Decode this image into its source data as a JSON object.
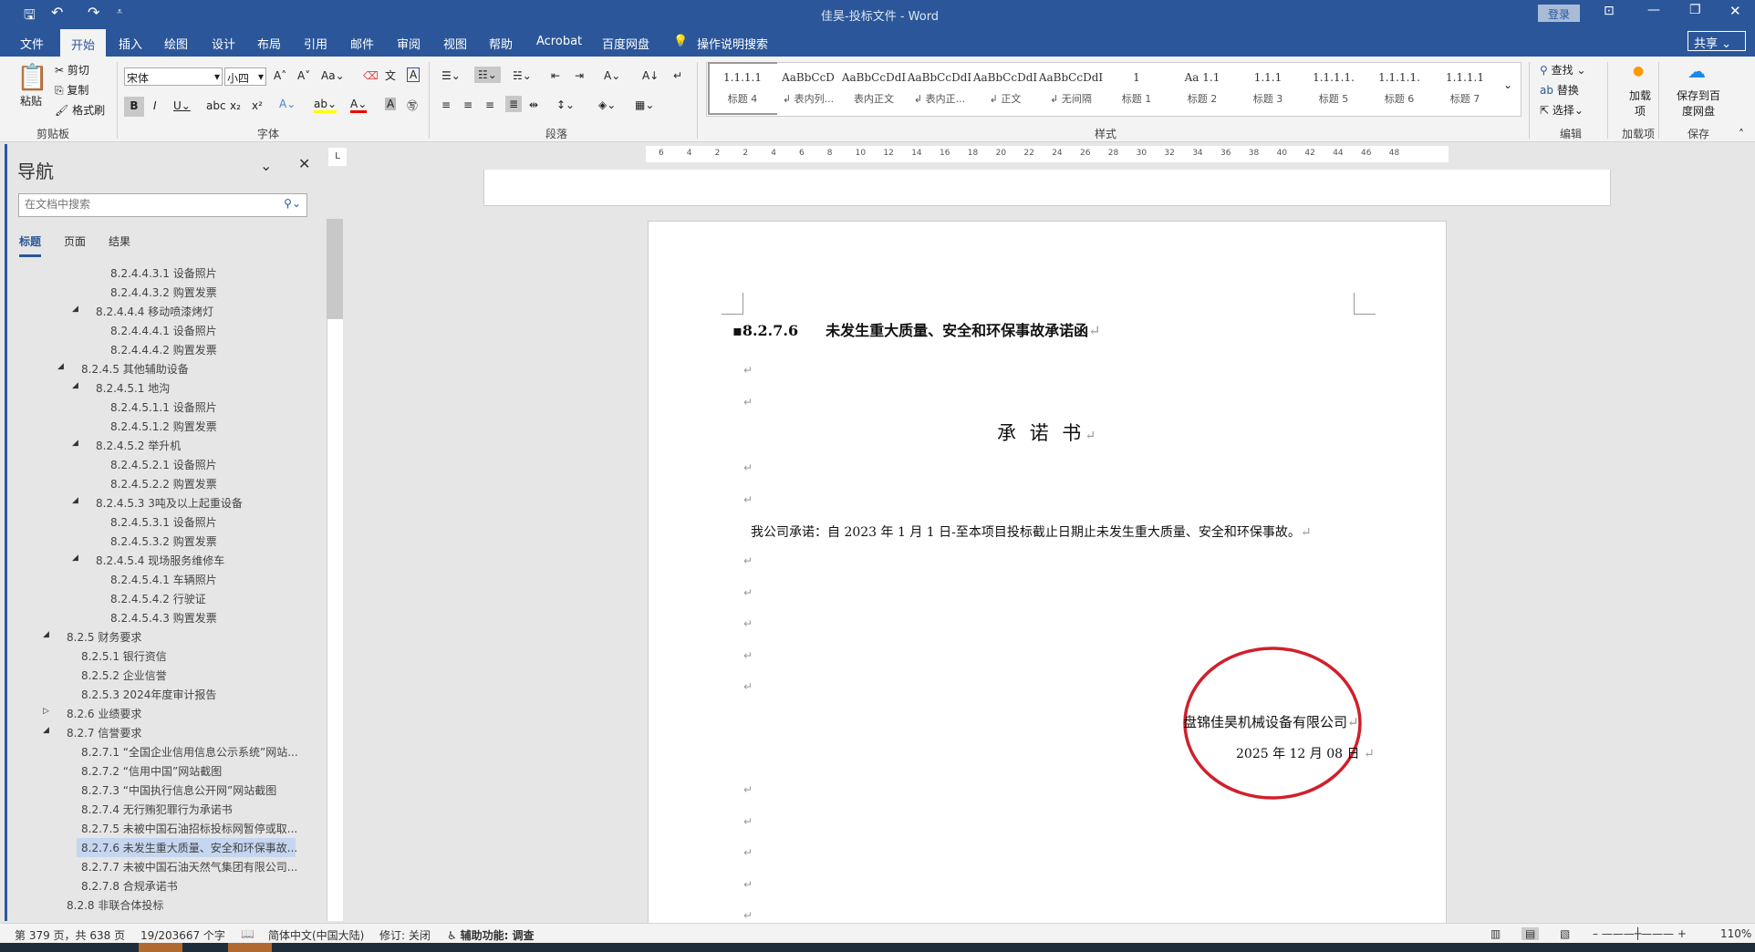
{
  "window": {
    "title": "佳昊-投标文件 - Word",
    "login": "登录",
    "share": "共享"
  },
  "tabs": [
    "文件",
    "开始",
    "插入",
    "绘图",
    "设计",
    "布局",
    "引用",
    "邮件",
    "审阅",
    "视图",
    "帮助",
    "Acrobat",
    "百度网盘"
  ],
  "tell_me": "操作说明搜索",
  "clipboard": {
    "paste": "粘贴",
    "cut": "剪切",
    "copy": "复制",
    "format_painter": "格式刷",
    "label": "剪贴板"
  },
  "font": {
    "name": "宋体",
    "size": "小四",
    "label": "字体"
  },
  "paragraph": {
    "label": "段落"
  },
  "styles": {
    "label": "样式",
    "items": [
      {
        "preview": "1.1.1.1",
        "name": "标题 4"
      },
      {
        "preview": "AaBbCcD",
        "name": "↲ 表内列..."
      },
      {
        "preview": "AaBbCcDdI",
        "name": "表内正文"
      },
      {
        "preview": "AaBbCcDdI",
        "name": "↲ 表内正..."
      },
      {
        "preview": "AaBbCcDdI",
        "name": "↲ 正文"
      },
      {
        "preview": "AaBbCcDdI",
        "name": "↲ 无间隔"
      },
      {
        "preview": "1",
        "name": "标题 1"
      },
      {
        "preview": "Aa 1.1",
        "name": "标题 2"
      },
      {
        "preview": "1.1.1",
        "name": "标题 3"
      },
      {
        "preview": "1.1.1.1.",
        "name": "标题 5"
      },
      {
        "preview": "1.1.1.1.",
        "name": "标题 6"
      },
      {
        "preview": "1.1.1.1",
        "name": "标题 7"
      }
    ]
  },
  "editing": {
    "find": "查找",
    "replace": "替换",
    "select": "选择",
    "label": "编辑"
  },
  "addins": {
    "button": "加载项",
    "label": "加载项"
  },
  "save": {
    "button": "保存到百度网盘",
    "label": "保存"
  },
  "nav": {
    "title": "导航",
    "search_placeholder": "在文档中搜索",
    "tabs": [
      "标题",
      "页面",
      "结果"
    ],
    "items": [
      {
        "t": "8.2.4.4.3.1 设备照片",
        "l": 4
      },
      {
        "t": "8.2.4.4.3.2 购置发票",
        "l": 4
      },
      {
        "t": "8.2.4.4.4 移动喷漆烤灯",
        "l": 3,
        "e": "open"
      },
      {
        "t": "8.2.4.4.4.1 设备照片",
        "l": 4
      },
      {
        "t": "8.2.4.4.4.2 购置发票",
        "l": 4
      },
      {
        "t": "8.2.4.5 其他辅助设备",
        "l": 2,
        "e": "open"
      },
      {
        "t": "8.2.4.5.1 地沟",
        "l": 3,
        "e": "open"
      },
      {
        "t": "8.2.4.5.1.1 设备照片",
        "l": 4
      },
      {
        "t": "8.2.4.5.1.2 购置发票",
        "l": 4
      },
      {
        "t": "8.2.4.5.2 举升机",
        "l": 3,
        "e": "open"
      },
      {
        "t": "8.2.4.5.2.1 设备照片",
        "l": 4
      },
      {
        "t": "8.2.4.5.2.2 购置发票",
        "l": 4
      },
      {
        "t": "8.2.4.5.3 3吨及以上起重设备",
        "l": 3,
        "e": "open"
      },
      {
        "t": "8.2.4.5.3.1 设备照片",
        "l": 4
      },
      {
        "t": "8.2.4.5.3.2 购置发票",
        "l": 4
      },
      {
        "t": "8.2.4.5.4 现场服务维修车",
        "l": 3,
        "e": "open"
      },
      {
        "t": "8.2.4.5.4.1 车辆照片",
        "l": 4
      },
      {
        "t": "8.2.4.5.4.2 行驶证",
        "l": 4
      },
      {
        "t": "8.2.4.5.4.3 购置发票",
        "l": 4
      },
      {
        "t": "8.2.5 财务要求",
        "l": 1,
        "e": "open"
      },
      {
        "t": "8.2.5.1 银行资信",
        "l": 2
      },
      {
        "t": "8.2.5.2 企业信誉",
        "l": 2
      },
      {
        "t": "8.2.5.3 2024年度审计报告",
        "l": 2
      },
      {
        "t": "8.2.6 业绩要求",
        "l": 1,
        "e": "closed"
      },
      {
        "t": "8.2.7 信誉要求",
        "l": 1,
        "e": "open"
      },
      {
        "t": "8.2.7.1 “全国企业信用信息公示系统”网站...",
        "l": 2
      },
      {
        "t": "8.2.7.2 “信用中国”网站截图",
        "l": 2
      },
      {
        "t": "8.2.7.3 “中国执行信息公开网”网站截图",
        "l": 2
      },
      {
        "t": "8.2.7.4 无行贿犯罪行为承诺书",
        "l": 2
      },
      {
        "t": "8.2.7.5 未被中国石油招标投标网暂停或取...",
        "l": 2
      },
      {
        "t": "8.2.7.6 未发生重大质量、安全和环保事故...",
        "l": 2,
        "sel": true
      },
      {
        "t": "8.2.7.7 未被中国石油天然气集团有限公司...",
        "l": 2
      },
      {
        "t": "8.2.7.8 合规承诺书",
        "l": 2
      },
      {
        "t": "8.2.8 非联合体投标",
        "l": 1
      }
    ]
  },
  "ruler": {
    "left": [
      "6",
      "4",
      "2"
    ],
    "main": [
      "2",
      "4",
      "6",
      "8",
      "10",
      "12",
      "14",
      "16",
      "18",
      "20",
      "22",
      "24",
      "26",
      "28",
      "30",
      "32",
      "34",
      "36",
      "38",
      "40",
      "42"
    ],
    "right": [
      "44",
      "46",
      "48"
    ]
  },
  "document": {
    "heading_num": "8.2.7.6",
    "heading": "未发生重大质量、安全和环保事故承诺函",
    "title": "承 诺 书",
    "body": "我公司承诺：自 2023 年 1 月 1 日-至本项目投标截止日期止未发生重大质量、安全和环保事故。",
    "company": "盘锦佳昊机械设备有限公司",
    "date": "2025 年 12 月 08 日",
    "para_mark": "↵",
    "seal_color": "#d0202c"
  },
  "status": {
    "page": "第 379 页，共 638 页",
    "words": "19/203667 个字",
    "language": "简体中文(中国大陆)",
    "track": "修订: 关闭",
    "accessibility": "辅助功能: 调查",
    "zoom": "110%"
  }
}
